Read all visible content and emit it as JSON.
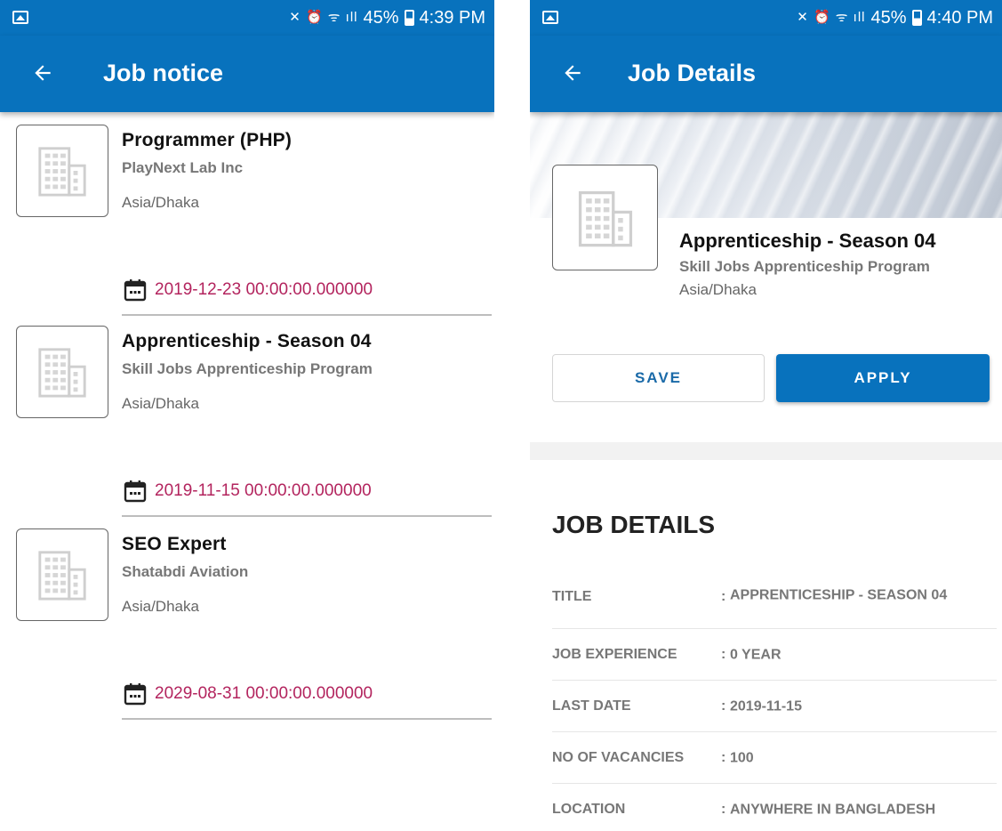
{
  "left_screen": {
    "status": {
      "battery": "45%",
      "time": "4:39 PM",
      "glyphs": "✕ ⏰ ᯤ ıll"
    },
    "app_bar": {
      "title": "Job notice"
    },
    "jobs": [
      {
        "title": "Programmer (PHP)",
        "company": "PlayNext Lab Inc",
        "location": "Asia/Dhaka",
        "date": "2019-12-23 00:00:00.000000"
      },
      {
        "title": "Apprenticeship - Season 04",
        "company": "Skill Jobs Apprenticeship Program",
        "location": "Asia/Dhaka",
        "date": "2019-11-15 00:00:00.000000"
      },
      {
        "title": "SEO Expert",
        "company": "Shatabdi Aviation",
        "location": "Asia/Dhaka",
        "date": "2029-08-31 00:00:00.000000"
      }
    ]
  },
  "right_screen": {
    "status": {
      "battery": "45%",
      "time": "4:40 PM",
      "glyphs": "✕ ⏰ ᯤ ıll"
    },
    "app_bar": {
      "title": "Job Details"
    },
    "job": {
      "title": "Apprenticeship - Season 04",
      "company": "Skill Jobs Apprenticeship Program",
      "location": "Asia/Dhaka"
    },
    "buttons": {
      "save": "SAVE",
      "apply": "APPLY"
    },
    "section_heading": "JOB DETAILS",
    "details": [
      {
        "label": "TITLE",
        "value": "APPRENTICESHIP - SEASON 04"
      },
      {
        "label": "JOB EXPERIENCE",
        "value": "0 YEAR"
      },
      {
        "label": "LAST DATE",
        "value": "2019-11-15"
      },
      {
        "label": "NO OF VACANCIES",
        "value": "100"
      },
      {
        "label": "LOCATION",
        "value": "ANYWHERE IN BANGLADESH"
      }
    ]
  },
  "colors": {
    "primary": "#0872bd",
    "date_text": "#b3245e"
  },
  "icons": {
    "back": "arrow-left-icon",
    "company_logo": "building-icon",
    "date": "calendar-icon",
    "gallery": "gallery-icon"
  }
}
